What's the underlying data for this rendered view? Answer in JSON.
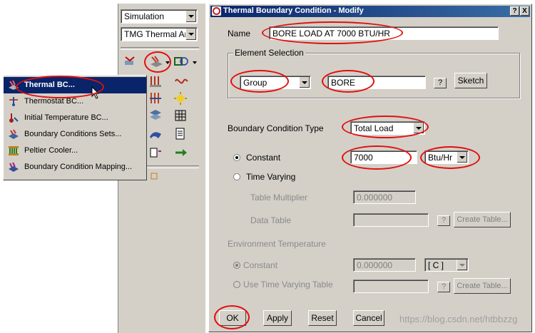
{
  "left_panel": {
    "dropdowns": [
      {
        "value": "Simulation"
      },
      {
        "value": "TMG Thermal Anal"
      }
    ]
  },
  "context_menu": {
    "items": [
      {
        "label": "Thermal BC...",
        "icon": "thermal-bc-icon",
        "selected": true
      },
      {
        "label": "Thermostat BC...",
        "icon": "thermostat-icon"
      },
      {
        "label": "Initial Temperature BC...",
        "icon": "initial-temperature-icon"
      },
      {
        "label": "Boundary Conditions Sets...",
        "icon": "bc-sets-icon"
      },
      {
        "label": "Peltier Cooler...",
        "icon": "peltier-icon"
      },
      {
        "label": "Boundary Condition Mapping...",
        "icon": "bc-mapping-icon"
      }
    ]
  },
  "dialog": {
    "title": "Thermal Boundary Condition - Modify",
    "help_button": "?",
    "close_button": "X",
    "name_label": "Name",
    "name_value": "BORE LOAD AT 7000 BTU/HR",
    "element_selection": {
      "legend": "Element Selection",
      "type_value": "Group",
      "group_value": "BORE",
      "help_label": "?",
      "sketch_label": "Sketch"
    },
    "bc_type_label": "Boundary Condition Type",
    "bc_type_value": "Total Load",
    "constant_label": "Constant",
    "constant_value": "7000",
    "unit_value": "Btu/Hr",
    "time_varying_label": "Time Varying",
    "table_multiplier_label": "Table Multiplier",
    "table_multiplier_value": "0.000000",
    "data_table_label": "Data Table",
    "data_table_help": "?",
    "create_table_label": "Create Table...",
    "env_temp_label": "Environment Temperature",
    "env_constant_label": "Constant",
    "env_constant_value": "0.000000",
    "env_unit_value": "[ C ]",
    "use_time_varying_label": "Use Time Varying Table",
    "env_help": "?",
    "env_create_table_label": "Create Table...",
    "ok_label": "OK",
    "apply_label": "Apply",
    "reset_label": "Reset",
    "cancel_label": "Cancel"
  },
  "watermark": "https://blog.csdn.net/htbbzzg",
  "colors": {
    "dialog_bg": "#d4d0c8",
    "title_bar": "#0a246a",
    "selection": "#0a246a",
    "annotation_ring": "#e01010"
  }
}
